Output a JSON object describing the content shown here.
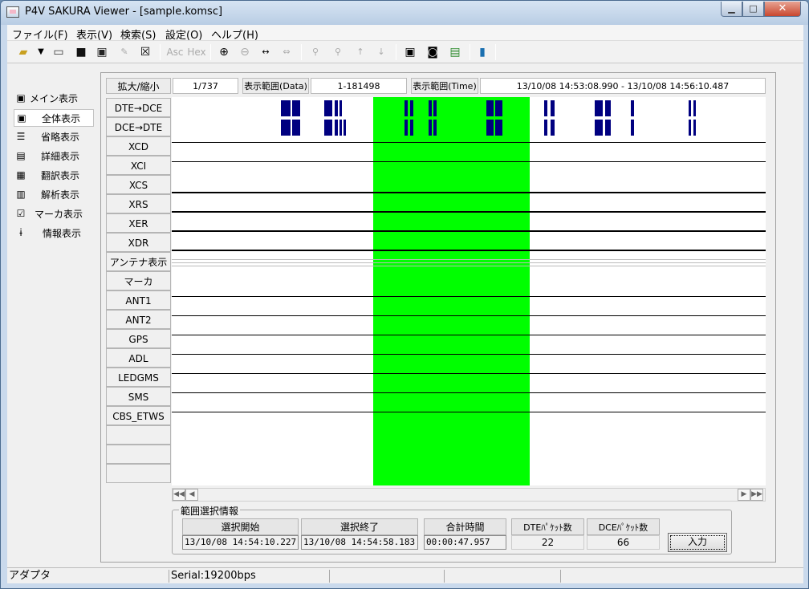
{
  "window": {
    "title": "P4V SAKURA Viewer - [sample.komsc]"
  },
  "menu": [
    "ファイル(F)",
    "表示(V)",
    "検索(S)",
    "設定(O)",
    "ヘルプ(H)"
  ],
  "toolbar": {
    "asc_label": "Asc",
    "hex_label": "Hex"
  },
  "sidebar": {
    "items": [
      {
        "label": "メイン表示",
        "icon": "monitor-icon"
      },
      {
        "label": "全体表示",
        "icon": "monitor-icon",
        "selected": true
      },
      {
        "label": "省略表示",
        "icon": "list-icon"
      },
      {
        "label": "詳細表示",
        "icon": "detail-icon"
      },
      {
        "label": "翻訳表示",
        "icon": "translate-icon"
      },
      {
        "label": "解析表示",
        "icon": "analysis-icon"
      },
      {
        "label": "マーカ表示",
        "icon": "checkbox-icon"
      },
      {
        "label": "情報表示",
        "icon": "info-icon"
      }
    ]
  },
  "info_bar": {
    "zoom_label": "拡大/縮小",
    "zoom_value": "1/737",
    "data_range_label": "表示範囲(Data)",
    "data_range_value": "1-181498",
    "time_range_label": "表示範囲(Time)",
    "time_range_value": "13/10/08 14:53:08.990 - 13/10/08 14:56:10.487"
  },
  "signals": [
    "DTE→DCE",
    "DCE→DTE",
    "XCD",
    "XCI",
    "XCS",
    "XRS",
    "XER",
    "XDR",
    "アンテナ表示",
    "マーカ",
    "ANT1",
    "ANT2",
    "GPS",
    "ADL",
    "LEDGMS",
    "SMS",
    "CBS_ETWS",
    "",
    "",
    ""
  ],
  "colors": {
    "selection": "#00ff00",
    "packet": "#000080"
  },
  "range_info": {
    "group_title": "範囲選択情報",
    "start_label": "選択開始",
    "start_value": "13/10/08 14:54:10.227",
    "end_label": "選択終了",
    "end_value": "13/10/08 14:54:58.183",
    "total_label": "合計時間",
    "total_value": "00:00:47.957",
    "dte_label": "DTEﾊﾟｹｯﾄ数",
    "dte_value": "22",
    "dce_label": "DCEﾊﾟｹｯﾄ数",
    "dce_value": "66",
    "input_label": "入力"
  },
  "status": {
    "left": "アダプタ",
    "serial": "Serial:19200bps"
  }
}
